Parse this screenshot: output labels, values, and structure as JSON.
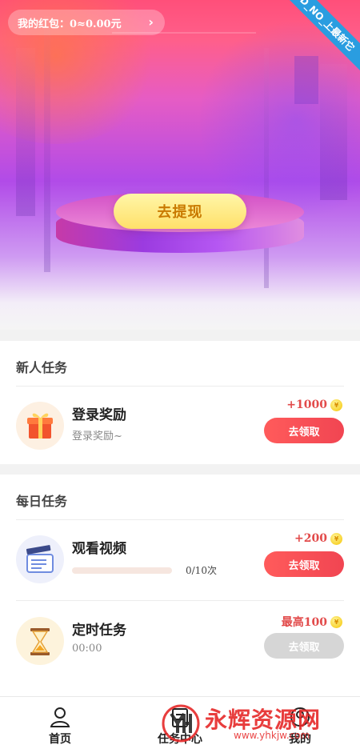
{
  "hero": {
    "red_packet_label": "我的红包：0≈0.00元",
    "chevron": "›",
    "ribbon_text": "D_NO_上最新它",
    "withdraw_label": "去提现"
  },
  "newbie": {
    "title": "新人任务",
    "tasks": [
      {
        "name": "登录奖励",
        "subtitle": "登录奖励~",
        "reward": "+1000",
        "button": "去领取",
        "icon": "gift-icon"
      }
    ]
  },
  "daily": {
    "title": "每日任务",
    "tasks": [
      {
        "name": "观看视频",
        "progress_text": "0/10次",
        "progress": 0,
        "reward": "+200",
        "button": "去领取",
        "icon": "clapperboard-icon"
      },
      {
        "name": "定时任务",
        "subtitle": "00:00",
        "reward": "最高100",
        "button": "去领取",
        "button_state": "disabled",
        "icon": "hourglass-icon"
      }
    ]
  },
  "coin_glyph": "¥",
  "nav": {
    "items": [
      {
        "label": "首页",
        "icon": "person-icon"
      },
      {
        "label": "任务中心",
        "icon": "task-icon"
      },
      {
        "label": "我的",
        "icon": "profile-icon"
      }
    ]
  },
  "watermark": {
    "text": "永辉资源网",
    "url": "www.yhkjw.com"
  },
  "colors": {
    "accent_red": "#f14552",
    "gold": "#ffe06a",
    "disabled": "#d6d6d6"
  }
}
